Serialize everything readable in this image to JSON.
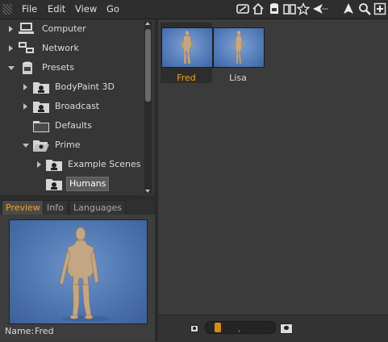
{
  "menubar": {
    "items": [
      "File",
      "Edit",
      "View",
      "Go"
    ]
  },
  "toolbar": {
    "icons": [
      "layout-icon",
      "home-icon",
      "catalog-icon",
      "book-icon",
      "star-icon",
      "back-icon",
      "up-icon",
      "search-icon",
      "new-window-icon"
    ]
  },
  "tree": {
    "items": [
      {
        "label": "Computer",
        "icon": "computer-icon",
        "expanded": false,
        "selected": false
      },
      {
        "label": "Network",
        "icon": "network-icon",
        "expanded": false,
        "selected": false
      },
      {
        "label": "Presets",
        "icon": "preset-icon",
        "expanded": true,
        "selected": false
      },
      {
        "label": "BodyPaint 3D",
        "icon": "folder-icon",
        "expanded": false,
        "selected": false
      },
      {
        "label": "Broadcast",
        "icon": "folder-icon",
        "expanded": false,
        "selected": false
      },
      {
        "label": "Defaults",
        "icon": "folder-icon",
        "expanded": false,
        "selected": false
      },
      {
        "label": "Prime",
        "icon": "folder-open-icon",
        "expanded": true,
        "selected": false
      },
      {
        "label": "Example Scenes",
        "icon": "folder-icon",
        "expanded": false,
        "selected": false
      },
      {
        "label": "Humans",
        "icon": "folder-icon",
        "expanded": false,
        "selected": true
      }
    ]
  },
  "tabs": {
    "items": [
      "Preview",
      "Info",
      "Languages"
    ],
    "active": "Preview"
  },
  "preview": {
    "name_label": "Name:",
    "name_value": "Fred"
  },
  "content": {
    "items": [
      {
        "label": "Fred",
        "selected": true
      },
      {
        "label": "Lisa",
        "selected": false
      }
    ]
  },
  "colors": {
    "accent": "#f3a51d",
    "preview_bg": "#5a80bb"
  },
  "zoom": {
    "level": 0.12
  }
}
